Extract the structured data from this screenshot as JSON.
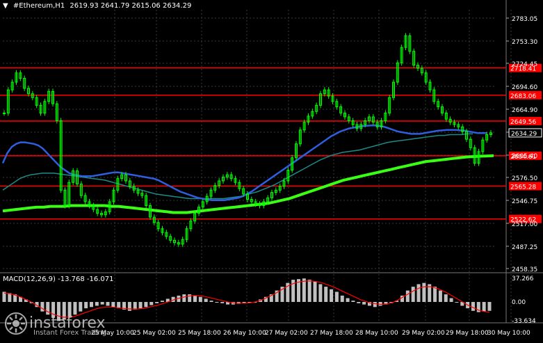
{
  "header": {
    "arrow": "▼",
    "symbol": "#Ethereum,H1",
    "ohlc": "2619.93 2641.79 2615.06 2634.29"
  },
  "macd": {
    "label": "MACD(12,26,9) -13.768 -16.071",
    "axis_labels": [
      "37.266",
      "0.00",
      "-33.634"
    ]
  },
  "logo": {
    "name": "instaforex",
    "tagline": "Instant Forex Trading"
  },
  "colors": {
    "background": "#000000",
    "candle": "#00ff00",
    "level_line": "#ff0000",
    "ma_fast": "#2f5fe0",
    "ma_mid": "#1f8a8a",
    "ma_slow": "#39ff14",
    "macd_hist": "#c0c0c0",
    "macd_signal": "#ff0000",
    "grid": "#3a3a3a"
  },
  "chart_data": {
    "type": "line",
    "title": "#Ethereum,H1",
    "price_axis_ticks": [
      "2783.05",
      "2753.30",
      "2724.45",
      "2694.60",
      "2664.90",
      "2635.15",
      "2605.40",
      "2576.50",
      "2546.75",
      "2517.00",
      "2487.25",
      "2458.35"
    ],
    "x_ticks": [
      "25 May 10:00",
      "25 May 02:00",
      "25 May 18:00",
      "26 May 10:00",
      "27 May 02:00",
      "27 May 18:00",
      "28 May 10:00",
      "29 May 02:00",
      "29 May 18:00",
      "30 May 10:00"
    ],
    "ylim": [
      2458.35,
      2783.05
    ],
    "current_price": 2634.29,
    "current_price_label": "2634.29",
    "levels": [
      {
        "value": 2718.41,
        "label": "2718.41"
      },
      {
        "value": 2683.06,
        "label": "2683.06"
      },
      {
        "value": 2649.56,
        "label": "2649.56"
      },
      {
        "value": 2604.61,
        "label": "2604.61"
      },
      {
        "value": 2565.28,
        "label": "2565.28"
      },
      {
        "value": 2522.62,
        "label": "2522.62"
      }
    ],
    "price_close": [
      2660,
      2690,
      2700,
      2712,
      2705,
      2692,
      2685,
      2680,
      2670,
      2660,
      2675,
      2688,
      2672,
      2650,
      2560,
      2540,
      2570,
      2585,
      2568,
      2553,
      2545,
      2540,
      2535,
      2530,
      2528,
      2532,
      2545,
      2560,
      2575,
      2580,
      2572,
      2565,
      2560,
      2556,
      2553,
      2540,
      2525,
      2518,
      2510,
      2505,
      2500,
      2495,
      2492,
      2490,
      2496,
      2510,
      2520,
      2530,
      2538,
      2545,
      2552,
      2560,
      2566,
      2572,
      2577,
      2580,
      2575,
      2570,
      2562,
      2555,
      2548,
      2545,
      2542,
      2540,
      2545,
      2550,
      2557,
      2560,
      2565,
      2572,
      2586,
      2602,
      2620,
      2638,
      2648,
      2656,
      2662,
      2670,
      2685,
      2690,
      2682,
      2675,
      2668,
      2660,
      2655,
      2650,
      2645,
      2640,
      2645,
      2650,
      2655,
      2648,
      2642,
      2650,
      2660,
      2680,
      2700,
      2725,
      2745,
      2760,
      2740,
      2722,
      2718,
      2712,
      2700,
      2690,
      2675,
      2668,
      2660,
      2652,
      2648,
      2645,
      2642,
      2636,
      2626,
      2615,
      2595,
      2610,
      2625,
      2632,
      2634.29
    ],
    "ma_fast": [
      2595,
      2608,
      2616,
      2620,
      2622,
      2622,
      2621,
      2620,
      2618,
      2614,
      2608,
      2602,
      2596,
      2590,
      2586,
      2582,
      2580,
      2579,
      2578,
      2578,
      2578,
      2579,
      2580,
      2581,
      2582,
      2583,
      2583,
      2582,
      2581,
      2580,
      2579,
      2578,
      2577,
      2576,
      2575,
      2573,
      2570,
      2567,
      2564,
      2561,
      2558,
      2556,
      2554,
      2552,
      2550,
      2549,
      2548,
      2547,
      2547,
      2547,
      2547,
      2548,
      2549,
      2550,
      2552,
      2555,
      2558,
      2562,
      2566,
      2570,
      2574,
      2578,
      2582,
      2586,
      2590,
      2594,
      2598,
      2602,
      2606,
      2610,
      2614,
      2618,
      2622,
      2626,
      2630,
      2633,
      2636,
      2638,
      2640,
      2641,
      2642,
      2643,
      2643.5,
      2644,
      2644,
      2643,
      2642,
      2640,
      2638,
      2636,
      2635,
      2634,
      2633,
      2633,
      2633,
      2634,
      2635,
      2636,
      2637,
      2637.5,
      2638,
      2638,
      2638,
      2637.5,
      2637,
      2636,
      2635,
      2634,
      2634,
      2634
    ],
    "ma_mid": [
      2560,
      2565,
      2570,
      2575,
      2578,
      2580,
      2581,
      2582,
      2582,
      2582,
      2581,
      2580,
      2579,
      2578,
      2577,
      2576,
      2575,
      2574,
      2573,
      2571,
      2569,
      2567,
      2565,
      2563,
      2561,
      2559,
      2557,
      2555,
      2554,
      2553,
      2552,
      2551,
      2550,
      2549,
      2549,
      2549,
      2549,
      2549,
      2549,
      2549,
      2550,
      2551,
      2552,
      2554,
      2556,
      2558,
      2561,
      2564,
      2567,
      2571,
      2575,
      2579,
      2583,
      2587,
      2591,
      2595,
      2599,
      2602,
      2605,
      2607,
      2609,
      2610,
      2611,
      2612,
      2614,
      2616,
      2618,
      2620,
      2622,
      2623,
      2624,
      2625,
      2626,
      2627,
      2628,
      2629,
      2630,
      2631,
      2631,
      2632,
      2632,
      2632,
      2633,
      2633
    ],
    "ma_slow": [
      2533,
      2534,
      2535,
      2536,
      2537,
      2538,
      2538,
      2539,
      2539,
      2539,
      2540,
      2540,
      2540,
      2540,
      2540,
      2540,
      2539,
      2539,
      2538,
      2537,
      2536,
      2535,
      2534,
      2533,
      2532,
      2531,
      2531,
      2531,
      2532,
      2533,
      2534,
      2535,
      2536,
      2537,
      2538,
      2539,
      2540,
      2541,
      2542,
      2543,
      2545,
      2547,
      2549,
      2552,
      2555,
      2558,
      2561,
      2564,
      2567,
      2570,
      2573,
      2575,
      2577,
      2579,
      2581,
      2583,
      2585,
      2587,
      2589,
      2591,
      2593,
      2595,
      2597,
      2598,
      2599,
      2600,
      2601,
      2602,
      2603,
      2603.5,
      2604,
      2604.3,
      2604.61
    ],
    "macd_histogram": [
      16,
      14,
      12,
      8,
      4,
      -2,
      -8,
      -15,
      -20,
      -25,
      -30,
      -28,
      -25,
      -20,
      -15,
      -10,
      -8,
      -6,
      -4,
      -6,
      -8,
      -10,
      -12,
      -14,
      -12,
      -10,
      -8,
      -5,
      -2,
      2,
      5,
      8,
      10,
      12,
      12,
      10,
      8,
      5,
      2,
      0,
      -2,
      -4,
      -4,
      -3,
      -2,
      -1,
      0,
      4,
      8,
      12,
      18,
      24,
      30,
      35,
      36,
      37,
      35,
      32,
      28,
      24,
      20,
      16,
      10,
      6,
      2,
      -2,
      -4,
      -6,
      -8,
      -6,
      -4,
      -2,
      2,
      10,
      18,
      24,
      28,
      30,
      28,
      24,
      18,
      12,
      6,
      0,
      -6,
      -10,
      -14,
      -16,
      -15,
      -14
    ],
    "macd_signal": [
      14,
      13,
      11,
      8,
      4,
      0,
      -5,
      -10,
      -15,
      -19,
      -22,
      -24,
      -24,
      -23,
      -20,
      -17,
      -14,
      -11,
      -9,
      -8,
      -8,
      -9,
      -10,
      -11,
      -11,
      -11,
      -10,
      -8,
      -6,
      -4,
      -1,
      2,
      5,
      7,
      9,
      10,
      10,
      9,
      7,
      5,
      3,
      1,
      -1,
      -2,
      -2,
      -2,
      -1,
      1,
      4,
      8,
      12,
      17,
      22,
      27,
      30,
      32,
      33,
      33,
      32,
      30,
      27,
      24,
      20,
      16,
      12,
      8,
      4,
      1,
      -2,
      -3,
      -4,
      -3,
      -1,
      3,
      8,
      13,
      18,
      22,
      24,
      24,
      22,
      19,
      15,
      10,
      5,
      0,
      -5,
      -9,
      -13,
      -15,
      -16.071
    ]
  }
}
